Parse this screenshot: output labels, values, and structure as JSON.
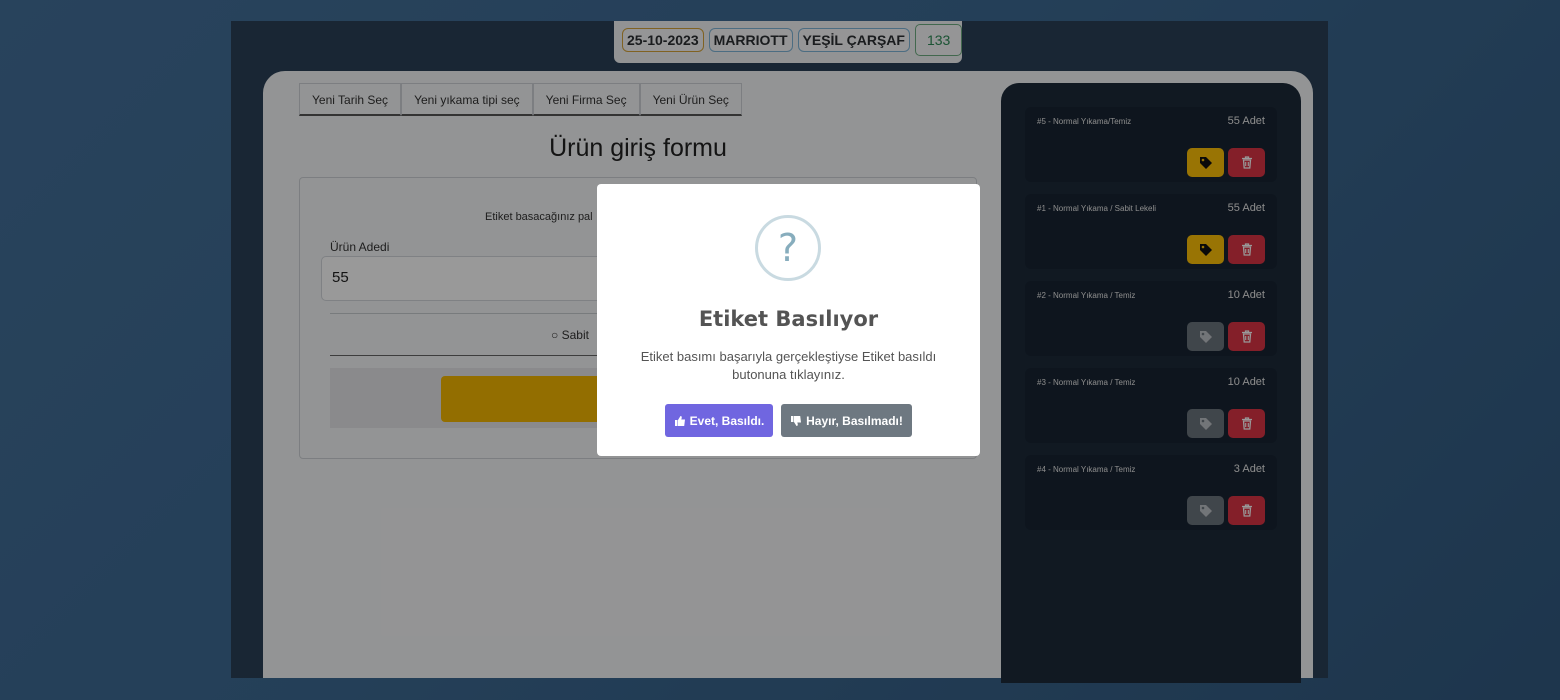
{
  "header": {
    "date": "25-10-2023",
    "company": "MARRIOTT",
    "product": "YEŞİL ÇARŞAF",
    "count": "133"
  },
  "tabs": [
    {
      "label": "Yeni Tarih Seç"
    },
    {
      "label": "Yeni yıkama tipi seç"
    },
    {
      "label": "Yeni Firma Seç"
    },
    {
      "label": "Yeni Ürün Seç"
    }
  ],
  "form": {
    "title": "Ürün giriş formu",
    "helper_text": "Etiket basacağınız pal",
    "quantity_label": "Ürün Adedi",
    "quantity_value": "55",
    "radio_label": "Sabit"
  },
  "sidebar": {
    "items": [
      {
        "title": "#5 - Normal Yıkama/Temiz",
        "count": "55 Adet",
        "tag_state": "active"
      },
      {
        "title": "#1 - Normal Yıkama / Sabit Lekeli",
        "count": "55 Adet",
        "tag_state": "active"
      },
      {
        "title": "#2 - Normal Yıkama / Temiz",
        "count": "10 Adet",
        "tag_state": "inactive"
      },
      {
        "title": "#3 - Normal Yıkama / Temiz",
        "count": "10 Adet",
        "tag_state": "inactive"
      },
      {
        "title": "#4 - Normal Yıkama / Temiz",
        "count": "3 Adet",
        "tag_state": "inactive"
      }
    ]
  },
  "modal": {
    "icon": "question-icon",
    "icon_glyph": "?",
    "title": "Etiket Basılıyor",
    "text": "Etiket basımı başarıyla gerçekleştiyse Etiket basıldı butonuna tıklayınız.",
    "confirm_label": "Evet, Basıldı.",
    "cancel_label": "Hayır, Basılmadı!"
  },
  "colors": {
    "confirm": "#7066e0",
    "cancel": "#6e7881",
    "tag_active": "#ffc107",
    "delete": "#dc3545"
  }
}
